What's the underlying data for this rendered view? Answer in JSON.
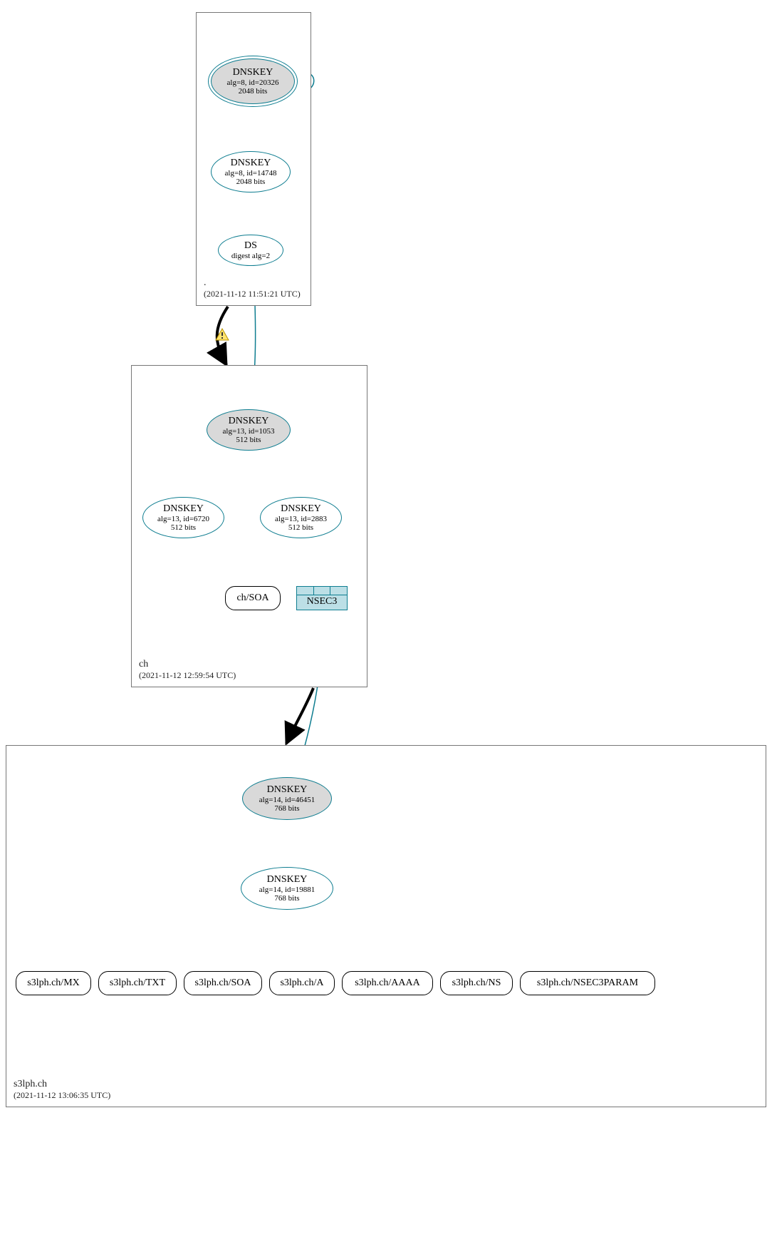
{
  "zones": {
    "root": {
      "name": ".",
      "timestamp": "(2021-11-12 11:51:21 UTC)",
      "nodes": {
        "ksk": {
          "title": "DNSKEY",
          "sub1": "alg=8, id=20326",
          "sub2": "2048 bits"
        },
        "zsk": {
          "title": "DNSKEY",
          "sub1": "alg=8, id=14748",
          "sub2": "2048 bits"
        },
        "ds": {
          "title": "DS",
          "sub1": "digest alg=2"
        }
      }
    },
    "ch": {
      "name": "ch",
      "timestamp": "(2021-11-12 12:59:54 UTC)",
      "nodes": {
        "ksk": {
          "title": "DNSKEY",
          "sub1": "alg=13, id=1053",
          "sub2": "512 bits"
        },
        "zsk1": {
          "title": "DNSKEY",
          "sub1": "alg=13, id=6720",
          "sub2": "512 bits"
        },
        "zsk2": {
          "title": "DNSKEY",
          "sub1": "alg=13, id=2883",
          "sub2": "512 bits"
        },
        "soa": {
          "label": "ch/SOA"
        },
        "nsec3": {
          "label": "NSEC3"
        }
      }
    },
    "s3lph": {
      "name": "s3lph.ch",
      "timestamp": "(2021-11-12 13:06:35 UTC)",
      "nodes": {
        "ksk": {
          "title": "DNSKEY",
          "sub1": "alg=14, id=46451",
          "sub2": "768 bits"
        },
        "zsk": {
          "title": "DNSKEY",
          "sub1": "alg=14, id=19881",
          "sub2": "768 bits"
        }
      },
      "records": [
        "s3lph.ch/MX",
        "s3lph.ch/TXT",
        "s3lph.ch/SOA",
        "s3lph.ch/A",
        "s3lph.ch/AAAA",
        "s3lph.ch/NS",
        "s3lph.ch/NSEC3PARAM"
      ]
    }
  },
  "colors": {
    "teal": "#0e7d90",
    "greyFill": "#d9d9d9",
    "nsecFill": "#bcdfe6"
  }
}
